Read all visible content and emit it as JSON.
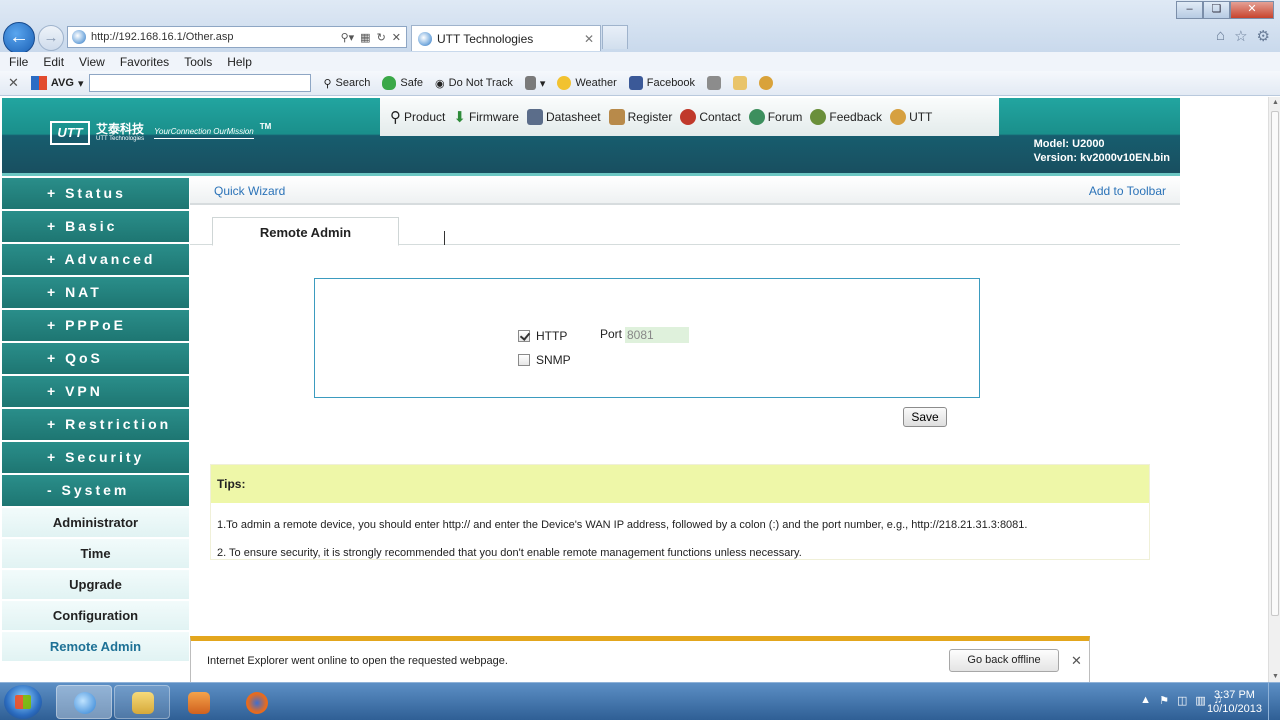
{
  "browser": {
    "url": "http://192.168.16.1/Other.asp",
    "tab_title": "UTT Technologies",
    "menu": [
      "File",
      "Edit",
      "View",
      "Favorites",
      "Tools",
      "Help"
    ],
    "toolbar": {
      "brand": "AVG",
      "search": "Search",
      "safe": "Safe",
      "do_not_track": "Do Not Track",
      "weather": "Weather",
      "facebook": "Facebook"
    }
  },
  "header": {
    "logo_box": "UTT",
    "logo_cn": "艾泰科技",
    "logo_en": "UTT Technologies",
    "slogan": "YourConnection OurMission",
    "trademark": "TM",
    "nav": [
      "Product",
      "Firmware",
      "Datasheet",
      "Register",
      "Contact",
      "Forum",
      "Feedback",
      "UTT"
    ],
    "model": "Model: U2000",
    "version": "Version: kv2000v10EN.bin"
  },
  "sidebar": {
    "items": [
      "+ Status",
      "+ Basic",
      "+ Advanced",
      "+ NAT",
      "+ PPPoE",
      "+ QoS",
      "+ VPN",
      "+ Restriction",
      "+ Security",
      "- System"
    ],
    "sub_items": [
      "Administrator",
      "Time",
      "Upgrade",
      "Configuration",
      "Remote Admin"
    ],
    "active_sub": "Remote Admin"
  },
  "content": {
    "quick_wizard": "Quick Wizard",
    "add_toolbar": "Add to Toolbar",
    "tab": "Remote Admin",
    "http_label": "HTTP",
    "snmp_label": "SNMP",
    "port_label": "Port",
    "port_value": "8081",
    "http_checked": true,
    "snmp_checked": false,
    "save": "Save",
    "tips_title": "Tips:",
    "tip1": "1.To admin a remote device, you should enter http:// and enter the Device's WAN IP address, followed by a colon (:) and the port number, e.g., http://218.21.31.3:8081.",
    "tip2": "2. To ensure security, it is strongly recommended that you don't enable remote management functions unless necessary."
  },
  "notification": {
    "message": "Internet Explorer went online to open the requested webpage.",
    "button": "Go back offline"
  },
  "taskbar": {
    "time": "3:37 PM",
    "date": "10/10/2013"
  },
  "colors": {
    "teal": "#1a8f8b",
    "dark_teal": "#175d6e",
    "link_blue": "#2b73b8",
    "tips_yellow": "#eef7a8",
    "notify_orange": "#e3a61d"
  }
}
